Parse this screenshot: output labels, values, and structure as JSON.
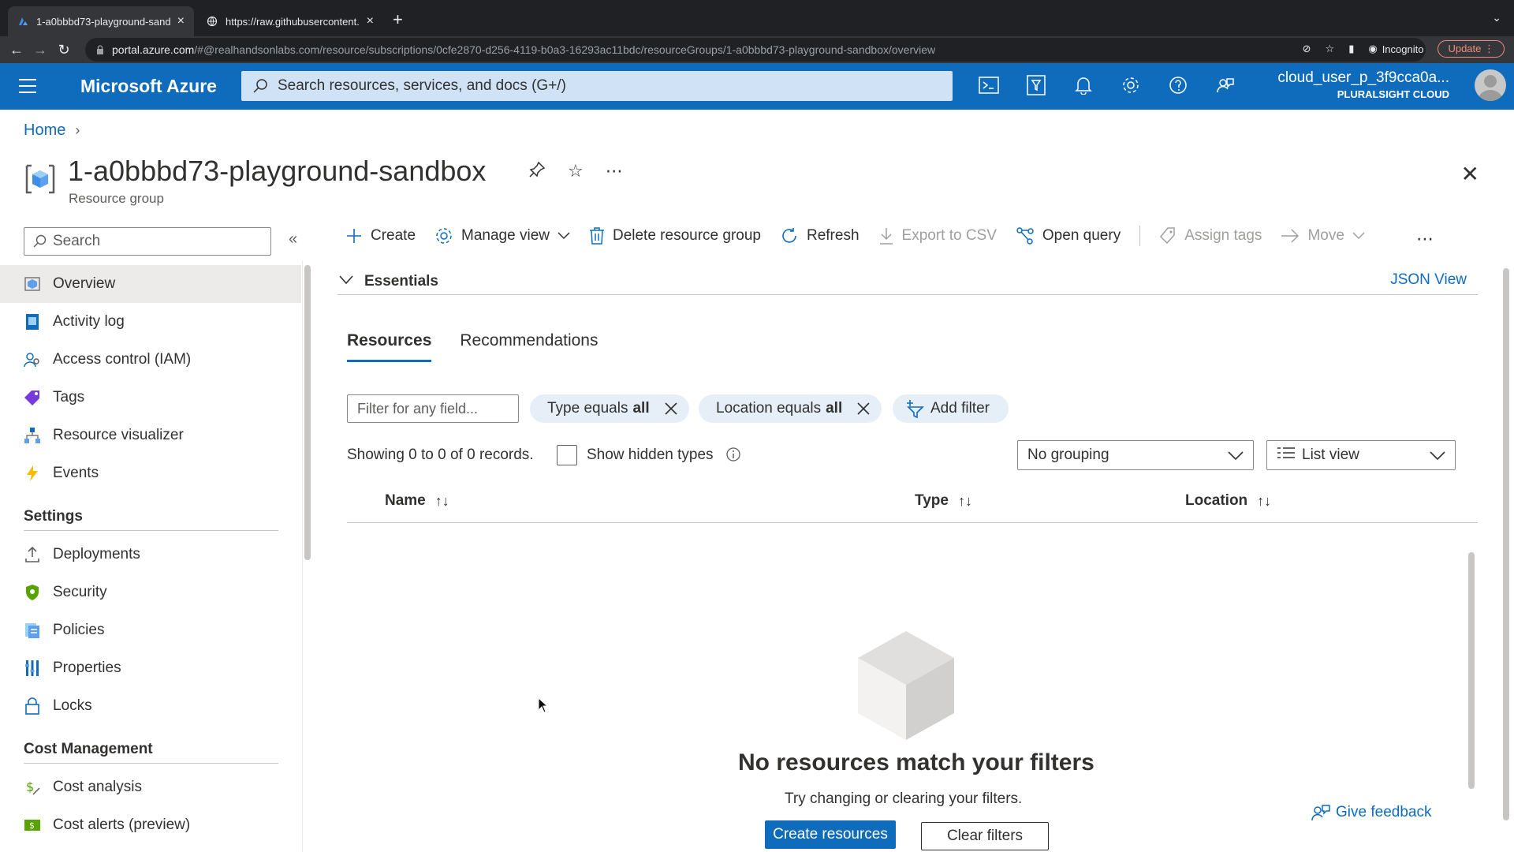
{
  "browser": {
    "tabs": [
      {
        "title": "1-a0bbbd73-playground-sandb",
        "active": true
      },
      {
        "title": "https://raw.githubusercontent.",
        "active": false
      }
    ],
    "new_tab": "+",
    "url_host": "portal.azure.com",
    "url_path": "/#@realhandsonlabs.com/resource/subscriptions/0cfe2870-d256-4119-b0a3-16293ac11bdc/resourceGroups/1-a0bbbd73-playground-sandbox/overview",
    "incognito_label": "Incognito",
    "update_label": "Update"
  },
  "header": {
    "brand": "Microsoft Azure",
    "search_placeholder": "Search resources, services, and docs (G+/)",
    "user_name": "cloud_user_p_3f9cca0a...",
    "tenant": "PLURALSIGHT CLOUD",
    "icons": [
      "cloud-shell-icon",
      "directory-filter-icon",
      "notifications-icon",
      "settings-icon",
      "help-icon",
      "feedback-icon"
    ]
  },
  "breadcrumb": {
    "home": "Home"
  },
  "resource": {
    "title": "1-a0bbbd73-playground-sandbox",
    "subtitle": "Resource group"
  },
  "left_nav": {
    "search_placeholder": "Search",
    "items": [
      {
        "label": "Overview",
        "selected": true
      },
      {
        "label": "Activity log"
      },
      {
        "label": "Access control (IAM)"
      },
      {
        "label": "Tags"
      },
      {
        "label": "Resource visualizer"
      },
      {
        "label": "Events"
      }
    ],
    "settings_title": "Settings",
    "settings_items": [
      {
        "label": "Deployments"
      },
      {
        "label": "Security"
      },
      {
        "label": "Policies"
      },
      {
        "label": "Properties"
      },
      {
        "label": "Locks"
      }
    ],
    "cost_title": "Cost Management",
    "cost_items": [
      {
        "label": "Cost analysis"
      },
      {
        "label": "Cost alerts (preview)"
      }
    ]
  },
  "commands": {
    "create": "Create",
    "manage_view": "Manage view",
    "delete": "Delete resource group",
    "refresh": "Refresh",
    "export": "Export to CSV",
    "open_query": "Open query",
    "assign_tags": "Assign tags",
    "move": "Move"
  },
  "essentials": {
    "title": "Essentials",
    "json_view": "JSON View"
  },
  "tabs": {
    "resources": "Resources",
    "recommendations": "Recommendations"
  },
  "filters": {
    "placeholder": "Filter for any field...",
    "type_pill": "Type equals",
    "type_value": "all",
    "location_pill": "Location equals",
    "location_value": "all",
    "add_filter": "Add filter"
  },
  "records": {
    "showing": "Showing 0 to 0 of 0 records.",
    "show_hidden": "Show hidden types",
    "grouping": "No grouping",
    "view": "List view"
  },
  "table": {
    "columns": [
      "Name",
      "Type",
      "Location"
    ]
  },
  "empty_state": {
    "title": "No resources match your filters",
    "text": "Try changing or clearing your filters.",
    "create_button": "Create resources",
    "clear_button": "Clear filters"
  },
  "feedback": "Give feedback",
  "colors": {
    "azure_blue": "#0f6cbd",
    "pill_bg": "#e6eef7"
  }
}
